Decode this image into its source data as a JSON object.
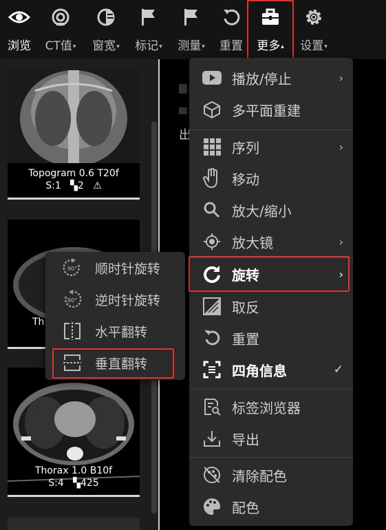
{
  "toolbar": {
    "items": [
      {
        "label": "浏览",
        "icon": "eye-icon"
      },
      {
        "label": "CT值",
        "icon": "target-icon"
      },
      {
        "label": "窗宽",
        "icon": "contrast-icon"
      },
      {
        "label": "标记",
        "icon": "flag-icon"
      },
      {
        "label": "测量",
        "icon": "flag-measure-icon"
      },
      {
        "label": "重置",
        "icon": "reset-icon"
      },
      {
        "label": "更多",
        "icon": "toolbox-icon"
      },
      {
        "label": "设置",
        "icon": "gear-icon"
      }
    ],
    "caret_down": "▾",
    "caret_up": "▴"
  },
  "thumbnails": [
    {
      "title": "Topogram 0.6 T20f",
      "series": "S:1",
      "count": "2",
      "warn": "⚠"
    },
    {
      "title": "Thorax 1.0 B10f",
      "series": "S:4",
      "count": "425"
    }
  ],
  "thumb2_partial": "Th",
  "more_menu": {
    "items": [
      {
        "label": "播放/停止",
        "icon": "play-icon",
        "submenu": true
      },
      {
        "label": "多平面重建",
        "icon": "cube-icon",
        "submenu": false
      },
      {
        "label": "序列",
        "icon": "grid-icon",
        "submenu": true
      },
      {
        "label": "移动",
        "icon": "hand-icon",
        "submenu": false
      },
      {
        "label": "放大/缩小",
        "icon": "zoom-icon",
        "submenu": false
      },
      {
        "label": "放大镜",
        "icon": "magnifier-icon",
        "submenu": true
      },
      {
        "label": "旋转",
        "icon": "rotate-icon",
        "submenu": true
      },
      {
        "label": "取反",
        "icon": "invert-icon",
        "submenu": false
      },
      {
        "label": "重置",
        "icon": "reset-icon",
        "submenu": false
      },
      {
        "label": "四角信息",
        "icon": "corner-info-icon",
        "submenu": false,
        "checked": true
      },
      {
        "label": "标签浏览器",
        "icon": "tag-browser-icon",
        "submenu": false
      },
      {
        "label": "导出",
        "icon": "export-icon",
        "submenu": false
      },
      {
        "label": "清除配色",
        "icon": "clear-palette-icon",
        "submenu": false
      },
      {
        "label": "配色",
        "icon": "palette-icon",
        "submenu": false
      }
    ],
    "chevron": "›",
    "check": "✓"
  },
  "rotate_submenu": {
    "items": [
      {
        "label": "顺时针旋转",
        "icon": "rotate-cw-90-icon"
      },
      {
        "label": "逆时针旋转",
        "icon": "rotate-ccw-90-icon"
      },
      {
        "label": "水平翻转",
        "icon": "flip-horizontal-icon"
      },
      {
        "label": "垂直翻转",
        "icon": "flip-vertical-icon"
      }
    ],
    "badge": "90°"
  },
  "viewer_partial_text": "出",
  "colors": {
    "highlight": "#e0332d",
    "menu_bg": "#2b2b2b",
    "toolbar_bg": "#141414"
  }
}
